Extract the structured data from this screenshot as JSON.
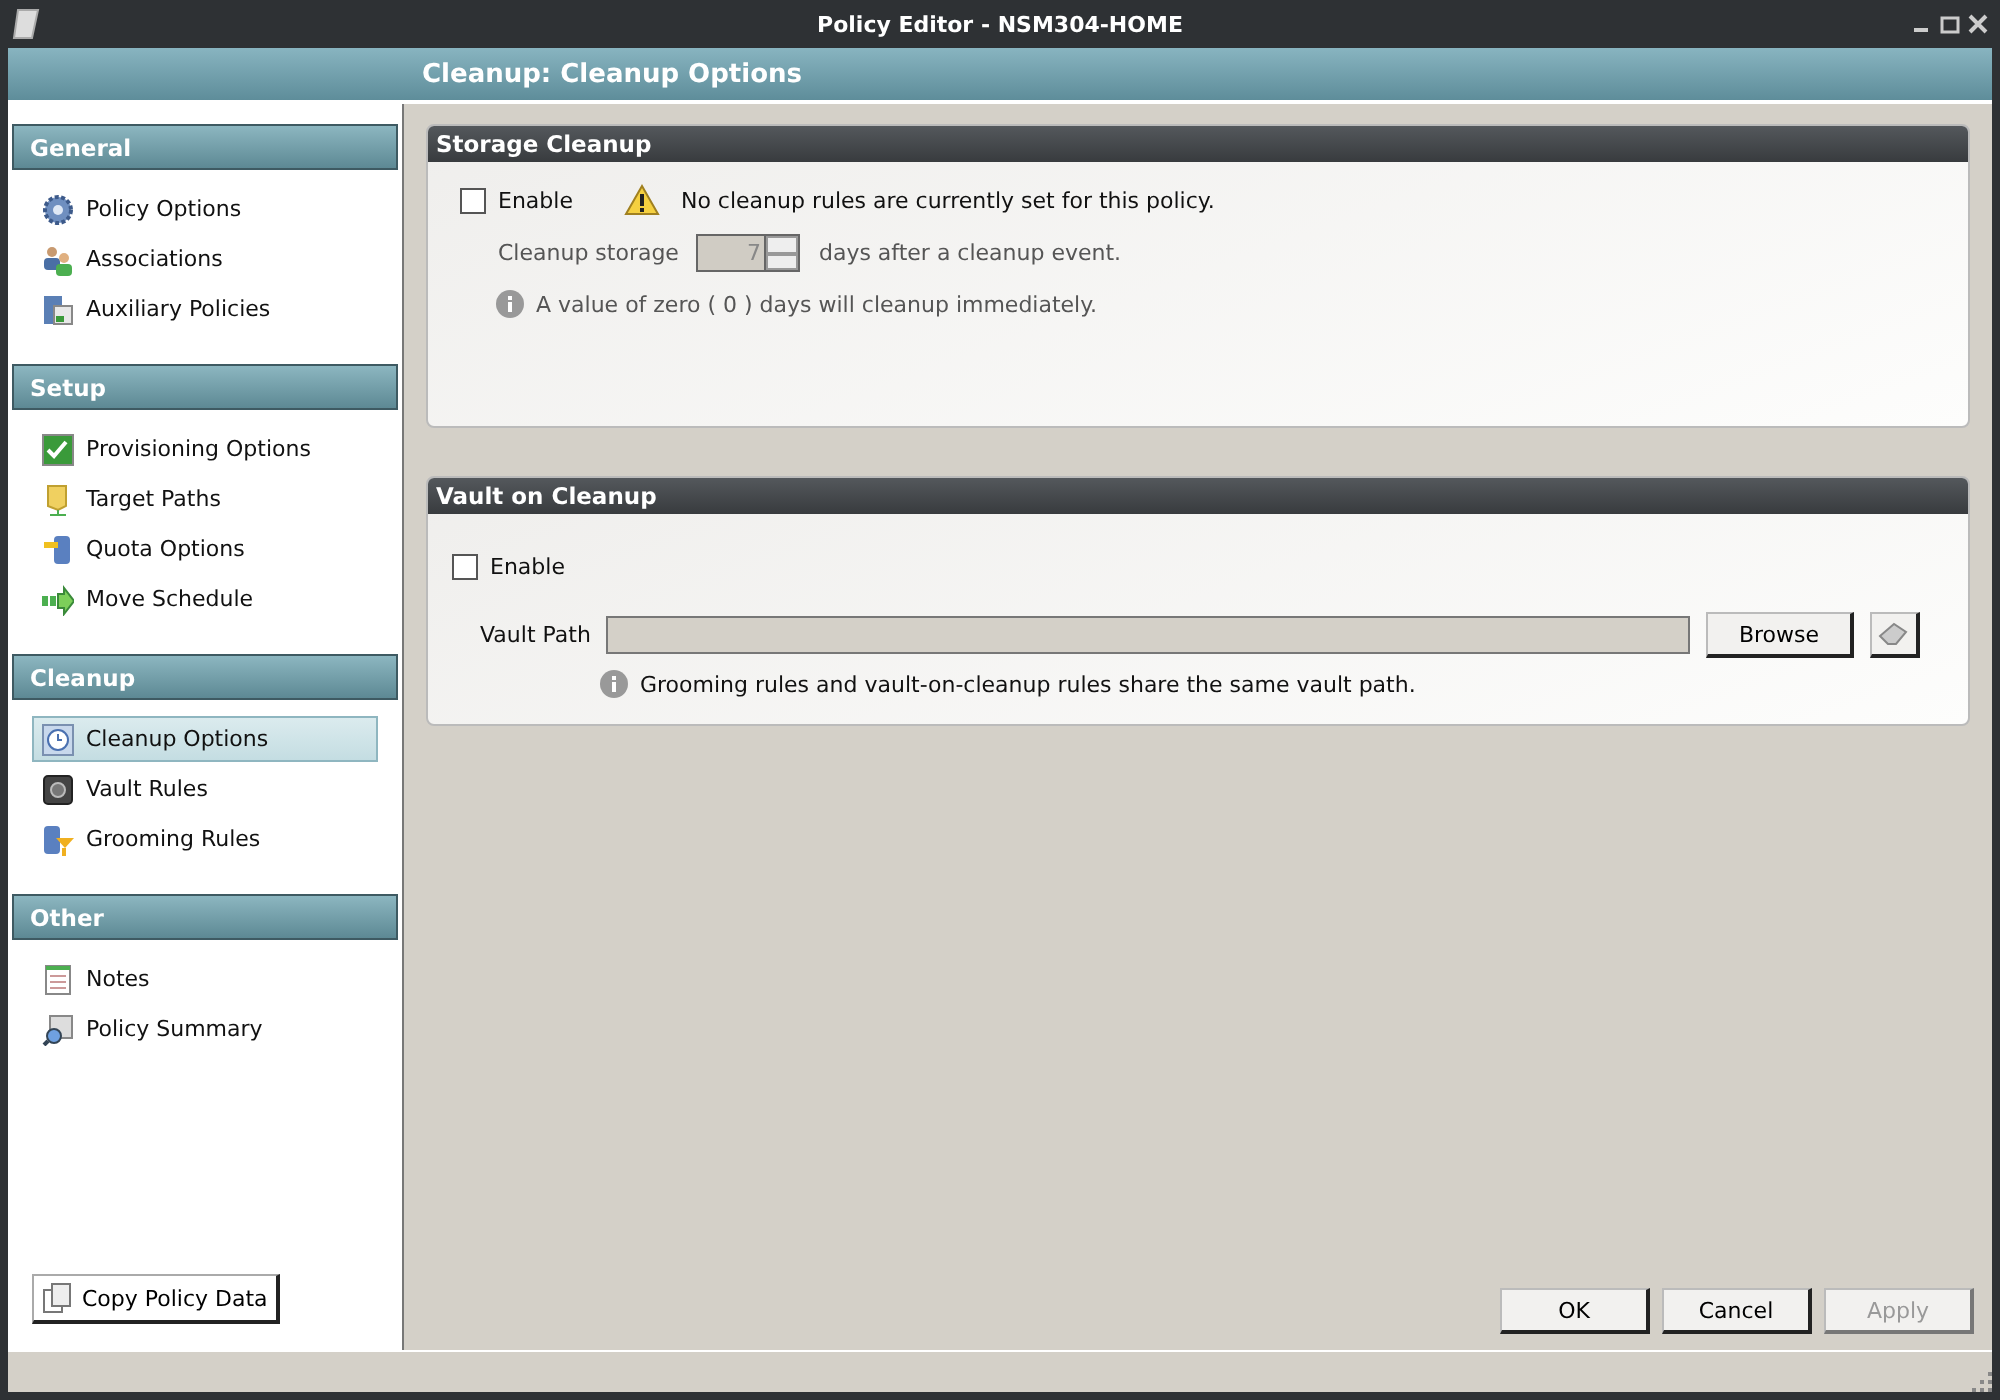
{
  "window": {
    "title": "Policy Editor - NSM304-HOME"
  },
  "header": {
    "title": "Cleanup: Cleanup Options"
  },
  "sidebar": {
    "sections": [
      {
        "title": "General",
        "items": [
          {
            "label": "Policy Options",
            "selected": false
          },
          {
            "label": "Associations",
            "selected": false
          },
          {
            "label": "Auxiliary Policies",
            "selected": false
          }
        ]
      },
      {
        "title": "Setup",
        "items": [
          {
            "label": "Provisioning Options",
            "selected": false
          },
          {
            "label": "Target Paths",
            "selected": false
          },
          {
            "label": "Quota Options",
            "selected": false
          },
          {
            "label": "Move Schedule",
            "selected": false
          }
        ]
      },
      {
        "title": "Cleanup",
        "items": [
          {
            "label": "Cleanup Options",
            "selected": true
          },
          {
            "label": "Vault Rules",
            "selected": false
          },
          {
            "label": "Grooming Rules",
            "selected": false
          }
        ]
      },
      {
        "title": "Other",
        "items": [
          {
            "label": "Notes",
            "selected": false
          },
          {
            "label": "Policy Summary",
            "selected": false
          }
        ]
      }
    ],
    "copy_button": "Copy Policy Data"
  },
  "storage_cleanup": {
    "title": "Storage Cleanup",
    "enable": {
      "label": "Enable",
      "checked": false
    },
    "warning": "No cleanup rules are currently set for this policy.",
    "storage_label": "Cleanup storage",
    "storage_value": "7",
    "storage_suffix": "days after a cleanup event.",
    "info": "A value of zero ( 0 ) days will cleanup immediately."
  },
  "vault_on_cleanup": {
    "title": "Vault on Cleanup",
    "enable": {
      "label": "Enable",
      "checked": false
    },
    "path_label": "Vault Path",
    "browse_button": "Browse",
    "info": "Grooming rules and vault-on-cleanup rules share the same vault path."
  },
  "buttons": [
    {
      "label": "OK",
      "disabled": false
    },
    {
      "label": "Cancel",
      "disabled": false
    },
    {
      "label": "Apply",
      "disabled": true
    }
  ]
}
